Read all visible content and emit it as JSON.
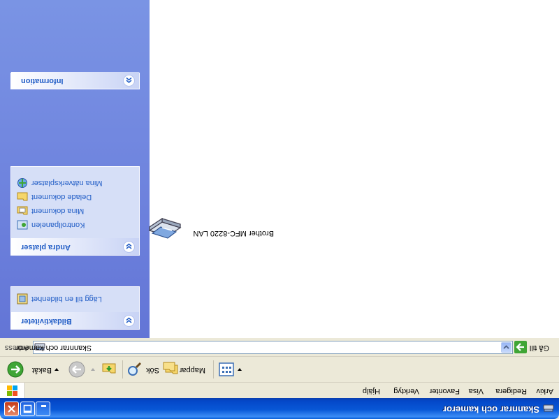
{
  "window": {
    "title": "Skannrar och kameror"
  },
  "menu": [
    "Arkiv",
    "Redigera",
    "Visa",
    "Favoriter",
    "Verktyg",
    "Hjälp"
  ],
  "toolbar": {
    "back": "Bakåt",
    "search": "Sök",
    "folders": "Mappar"
  },
  "address": {
    "label": "Adress",
    "value": "Skannrar och kameror",
    "go": "Gå till"
  },
  "tasks": {
    "image_tasks": {
      "title": "Bildaktiviteter",
      "items": [
        "Lägg till en bildenhet"
      ]
    },
    "other_places": {
      "title": "Andra platser",
      "items": [
        "Kontrollpanelen",
        "Mina dokument",
        "Delade dokument",
        "Mina nätverksplatser"
      ]
    },
    "information": {
      "title": "Information"
    }
  },
  "content": {
    "items": [
      "Brother MFC-8220 LAN"
    ]
  }
}
